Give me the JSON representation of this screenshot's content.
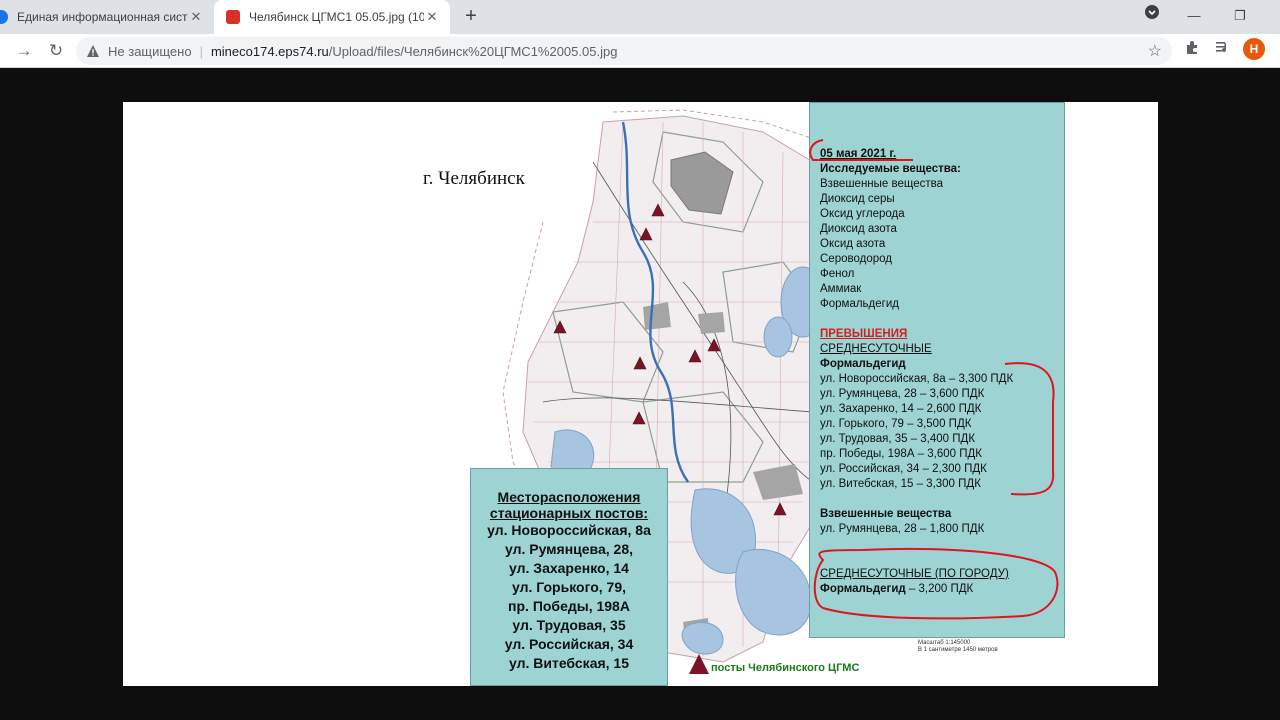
{
  "browser": {
    "tabs": [
      {
        "title": "Единая информационная систе",
        "active": false
      },
      {
        "title": "Челябинск ЦГМС1 05.05.jpg (10",
        "active": true
      }
    ],
    "new_tab": "+",
    "address": {
      "security_label": "Не защищено",
      "host": "mineco174.eps74.ru",
      "path": "/Upload/files/Челябинск%20ЦГМС1%2005.05.jpg"
    },
    "profile_initial": "Н",
    "icons": [
      "back-icon",
      "forward-icon",
      "reload-icon",
      "warning-icon",
      "star-icon",
      "extensions-icon",
      "media-icon",
      "downloads-icon"
    ]
  },
  "image": {
    "city_title": "г. Челябинск",
    "legend_box": {
      "heading": [
        "Месторасположения",
        "стационарных постов:"
      ],
      "items": [
        "ул. Новороссийская, 8а",
        "ул. Румянцева, 28,",
        "ул. Захаренко, 14",
        "ул. Горького, 79,",
        "пр. Победы, 198А",
        "ул. Трудовая, 35",
        "ул. Российская, 34",
        "ул. Витебская, 15"
      ]
    },
    "info": {
      "date": "05 мая 2021 г.",
      "substances_heading": "Исследуемые вещества:",
      "substances": [
        "Взвешенные вещества",
        "Диоксид серы",
        "Оксид углерода",
        "Диоксид азота",
        "Оксид азота",
        "Сероводород",
        "Фенол",
        "Аммиак",
        "Формальдегид"
      ],
      "exceed_heading": "ПРЕВЫШЕНИЯ",
      "daily_heading": "СРЕДНЕСУТОЧНЫЕ",
      "formaldehyde_label": "Формальдегид",
      "formaldehyde_items": [
        "ул. Новороссийская, 8а – 3,300 ПДК",
        "ул. Румянцева, 28 – 3,600 ПДК",
        "ул. Захаренко, 14 – 2,600  ПДК",
        "ул. Горького, 79 – 3,500 ПДК",
        "ул. Трудовая, 35 – 3,400 ПДК",
        "пр. Победы, 198А – 3,600 ПДК",
        "ул. Российская, 34 – 2,300 ПДК",
        "ул. Витебская, 15 – 3,300 ПДК"
      ],
      "suspended_label": "Взвешенные вещества",
      "suspended_item": "ул. Румянцева, 28 – 1,800 ПДК",
      "city_daily_heading": "СРЕДНЕСУТОЧНЫЕ  (ПО ГОРОДУ)",
      "city_formaldehyde_label": "Формальдегид",
      "city_formaldehyde_value": " – 3,200 ПДК"
    },
    "scale": [
      "Масштаб 1:145000",
      "В 1 сантиметре 1450 метров"
    ],
    "posts_legend": "посты Челябинского  ЦГМС",
    "colors": {
      "panel": "#9ed3d4",
      "marker": "#7a1528",
      "annotation": "#e0141c",
      "exceed": "#d41f1f"
    }
  }
}
